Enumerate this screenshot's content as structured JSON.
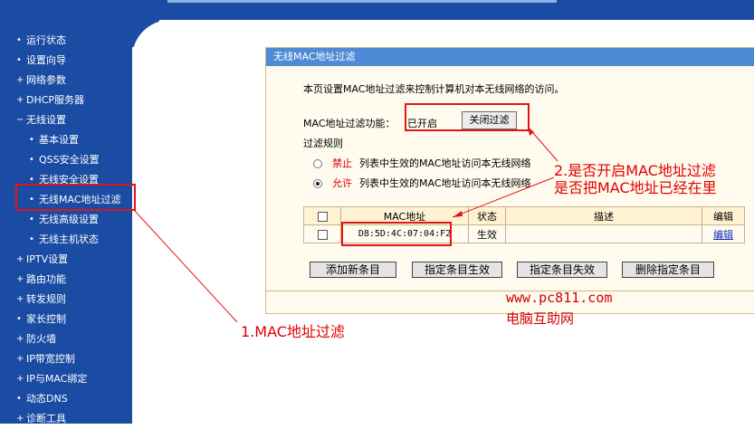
{
  "sidebar": {
    "items": [
      {
        "bullet": "•",
        "label": "运行状态"
      },
      {
        "bullet": "•",
        "label": "设置向导"
      },
      {
        "bullet": "+",
        "label": "网络参数"
      },
      {
        "bullet": "+",
        "label": "DHCP服务器"
      },
      {
        "bullet": "−",
        "label": "无线设置"
      },
      {
        "bullet": "•",
        "label": "基本设置"
      },
      {
        "bullet": "•",
        "label": "QSS安全设置"
      },
      {
        "bullet": "•",
        "label": "无线安全设置"
      },
      {
        "bullet": "•",
        "label": "无线MAC地址过滤"
      },
      {
        "bullet": "•",
        "label": "无线高级设置"
      },
      {
        "bullet": "•",
        "label": "无线主机状态"
      },
      {
        "bullet": "+",
        "label": "IPTV设置"
      },
      {
        "bullet": "+",
        "label": "路由功能"
      },
      {
        "bullet": "+",
        "label": "转发规则"
      },
      {
        "bullet": "•",
        "label": "家长控制"
      },
      {
        "bullet": "+",
        "label": "防火墙"
      },
      {
        "bullet": "+",
        "label": "IP带宽控制"
      },
      {
        "bullet": "+",
        "label": "IP与MAC绑定"
      },
      {
        "bullet": "•",
        "label": "动态DNS"
      },
      {
        "bullet": "+",
        "label": "诊断工具"
      }
    ]
  },
  "panel": {
    "title": "无线MAC地址过滤",
    "description": "本页设置MAC地址过滤来控制计算机对本无线网络的访问。",
    "filter_label": "MAC地址过滤功能：",
    "filter_status": "已开启",
    "toggle_button": "关闭过滤",
    "rules_label": "过滤规则",
    "rule_deny_word": "禁止",
    "rule_deny_text": "列表中生效的MAC地址访问本无线网络",
    "rule_allow_word": "允许",
    "rule_allow_text": "列表中生效的MAC地址访问本无线网络",
    "selected_rule": "allow"
  },
  "table": {
    "headers": {
      "mac": "MAC地址",
      "status": "状态",
      "desc": "描述",
      "edit": "编辑"
    },
    "rows": [
      {
        "mac": "D8:5D:4C:07:04:F2",
        "status": "生效",
        "desc": "",
        "edit": "编辑"
      }
    ]
  },
  "actions": {
    "add": "添加新条目",
    "enable": "指定条目生效",
    "disable": "指定条目失效",
    "delete": "删除指定条目"
  },
  "annotations": {
    "note1": "1.MAC地址过滤",
    "note2_line1": "2.是否开启MAC地址过滤",
    "note2_line2": "是否把MAC地址已经在里"
  },
  "watermark": {
    "url": "www.pc811.com",
    "name": "电脑互助网"
  },
  "colors": {
    "sidebar_bg": "#1a4ca3",
    "panel_header": "#4f8ad6",
    "panel_bg": "#fffbee",
    "annotation_red": "#e41414"
  }
}
